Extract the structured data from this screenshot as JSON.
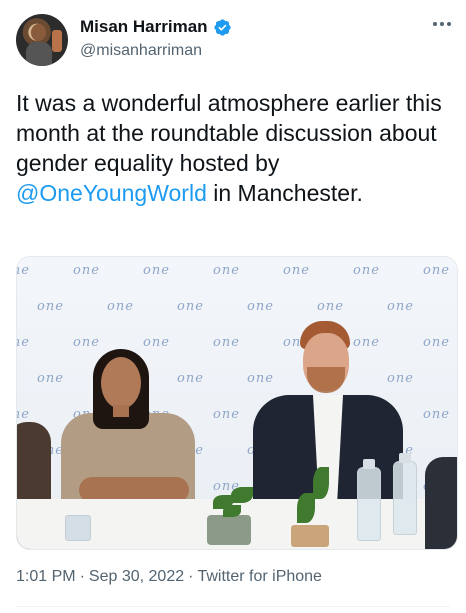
{
  "author": {
    "display_name": "Misan Harriman",
    "handle": "@misanharriman",
    "verified_icon": "verified-badge-icon",
    "verified_color": "#1d9bf0"
  },
  "tweet": {
    "text_before": "It was a wonderful atmosphere earlier this month at the roundtable discussion about gender equality hosted by ",
    "mention": "@OneYoungWorld",
    "text_after": " in Manchester."
  },
  "photo": {
    "backdrop_logo": "one"
  },
  "meta": {
    "time": "1:01 PM",
    "separator": "·",
    "date": "Sep 30, 2022",
    "source": "Twitter for iPhone"
  },
  "colors": {
    "accent": "#1d9bf0",
    "text": "#0f1419",
    "secondary": "#536471"
  }
}
